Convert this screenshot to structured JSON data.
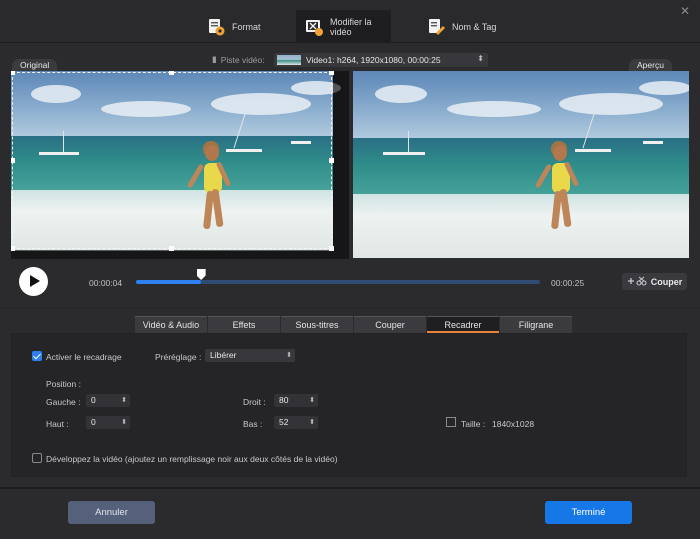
{
  "tabs": [
    {
      "label": "Format",
      "icon": "format-icon"
    },
    {
      "label": "Modifier la vidéo",
      "icon": "edit-video-icon"
    },
    {
      "label": "Nom & Tag",
      "icon": "name-tag-icon"
    }
  ],
  "preview": {
    "original_label": "Original",
    "apercu_label": "Aperçu",
    "track_label": "Piste vidéo:",
    "track_value": "Video1: h264, 1920x1080, 00:00:25"
  },
  "playback": {
    "current_time": "00:00:04",
    "total_time": "00:00:25",
    "progress": 0.16,
    "cut_label": "Couper"
  },
  "settings_tabs": [
    "Vidéo  & Audio",
    "Effets",
    "Sous-titres",
    "Couper",
    "Recadrer",
    "Filigrane"
  ],
  "active_settings_tab": "Recadrer",
  "crop": {
    "enable_label": "Activer le recadrage",
    "enabled": true,
    "preset_label": "Préréglage :",
    "preset_value": "Libérer",
    "position_label": "Position :",
    "left_label": "Gauche :",
    "left_value": "0",
    "top_label": "Haut :",
    "top_value": "0",
    "right_label": "Droit :",
    "right_value": "80",
    "bottom_label": "Bas :",
    "bottom_value": "52",
    "size_label": "Taille :",
    "size_value": "1840x1028",
    "expand_label": "Développez la vidéo (ajoutez un remplissage noir aux deux côtés de la vidéo)",
    "expand_enabled": false
  },
  "footer": {
    "cancel_label": "Annuler",
    "done_label": "Terminé"
  },
  "colors": {
    "accent": "#2e7ff0",
    "active_tab_underline": "#e8843a",
    "done_button": "#1678e6",
    "cancel_button": "#55607a"
  }
}
